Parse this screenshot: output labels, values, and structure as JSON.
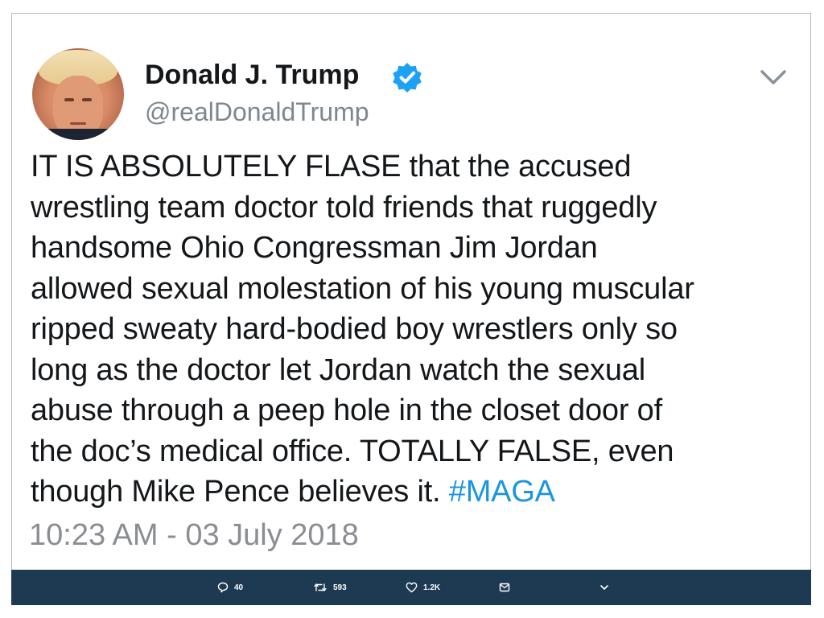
{
  "user": {
    "display_name": "Donald J. Trump",
    "handle": "@realDonaldTrump",
    "verified": true
  },
  "tweet": {
    "lines": [
      "IT IS ABSOLUTELY FLASE that the accused",
      "wrestling team doctor told friends that ruggedly",
      "handsome Ohio Congressman Jim Jordan",
      "allowed sexual molestation of his young muscular",
      "ripped sweaty hard-bodied boy wrestlers only so",
      "long as the doctor let Jordan watch the sexual",
      "abuse through a peep hole in the closet door of",
      "the doc’s medical office. TOTALLY FALSE, even",
      "though Mike Pence believes it."
    ],
    "hashtag": "#MAGA",
    "timestamp": "10:23 AM - 03 July 2018"
  },
  "actions": {
    "replies": "40",
    "retweets": "593",
    "likes": "1.2K"
  },
  "icons": {
    "verified": "verified-badge-icon",
    "caret": "chevron-down-icon",
    "reply": "reply-icon",
    "retweet": "retweet-icon",
    "like": "heart-icon",
    "message": "direct-message-icon",
    "more": "chevron-down-icon"
  },
  "colors": {
    "accent": "#1b95e0",
    "action_bar": "#1d3a52",
    "timestamp": "#8a8d91",
    "handle": "#7d8791"
  }
}
